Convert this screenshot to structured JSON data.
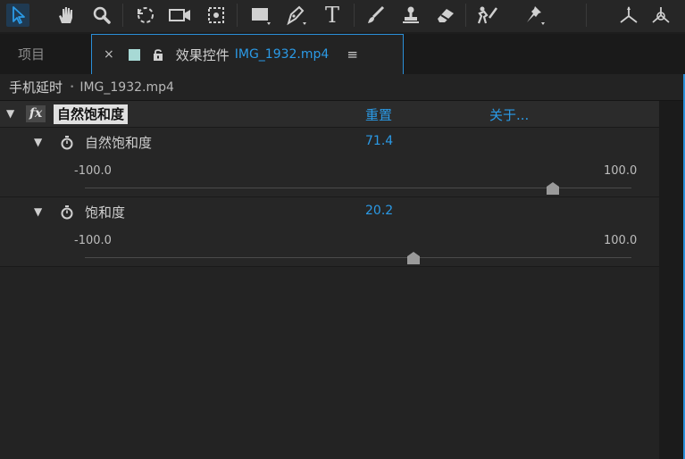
{
  "toolbar": {
    "tools": [
      {
        "icon": "selection-arrow-icon",
        "selected": true
      },
      {
        "icon": "hand-icon"
      },
      {
        "icon": "zoom-icon"
      },
      {
        "icon": "rotate-icon"
      },
      {
        "icon": "camera-icon"
      },
      {
        "icon": "pan-behind-icon"
      },
      {
        "icon": "rectangle-icon"
      },
      {
        "icon": "pen-icon"
      },
      {
        "icon": "type-icon",
        "glyph": "T"
      },
      {
        "icon": "brush-icon"
      },
      {
        "icon": "clone-stamp-icon"
      },
      {
        "icon": "eraser-icon"
      },
      {
        "icon": "roto-brush-icon"
      },
      {
        "icon": "puppet-pin-icon"
      },
      {
        "icon": "axis-local-icon"
      },
      {
        "icon": "axis-world-icon"
      }
    ],
    "accent": "#2b9ae6"
  },
  "tabs": {
    "project_label": "项目",
    "close_label": "×",
    "active_title": "效果控件",
    "active_file": "IMG_1932.mp4",
    "menu_label": "≡",
    "label_color": "#a7d9d5"
  },
  "breadcrumb": {
    "layer": "手机延时",
    "separator": "•",
    "clip": "IMG_1932.mp4"
  },
  "effect": {
    "fx_badge": "fx",
    "name": "自然饱和度",
    "reset_label": "重置",
    "about_label": "关于..."
  },
  "properties": [
    {
      "name": "自然饱和度",
      "value": "71.4",
      "min": "-100.0",
      "max": "100.0",
      "numeric": 71.4
    },
    {
      "name": "饱和度",
      "value": "20.2",
      "min": "-100.0",
      "max": "100.0",
      "numeric": 20.2
    }
  ]
}
